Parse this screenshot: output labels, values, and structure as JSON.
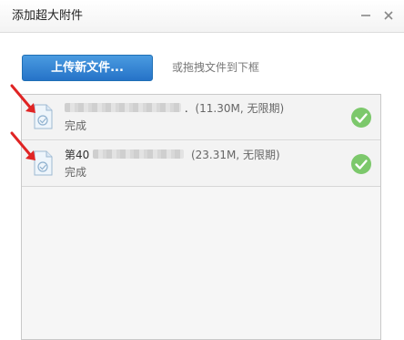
{
  "window": {
    "title": "添加超大附件",
    "minimize_icon": "minimize-icon",
    "close_icon": "close-icon"
  },
  "toolbar": {
    "upload_label": "上传新文件...",
    "drag_hint": "或拖拽文件到下框"
  },
  "files": [
    {
      "name_prefix": "",
      "name_suffix": ".",
      "meta": "(11.30M, 无限期)",
      "status": "完成",
      "icon": "file-icon",
      "status_icon": "check-circle-icon"
    },
    {
      "name_prefix": "第40",
      "name_suffix": "",
      "meta": "(23.31M, 无限期)",
      "status": "完成",
      "icon": "file-icon",
      "status_icon": "check-circle-icon"
    }
  ],
  "colors": {
    "accent": "#2f7fd0",
    "success": "#7cc86b",
    "annotation": "#e02424"
  }
}
